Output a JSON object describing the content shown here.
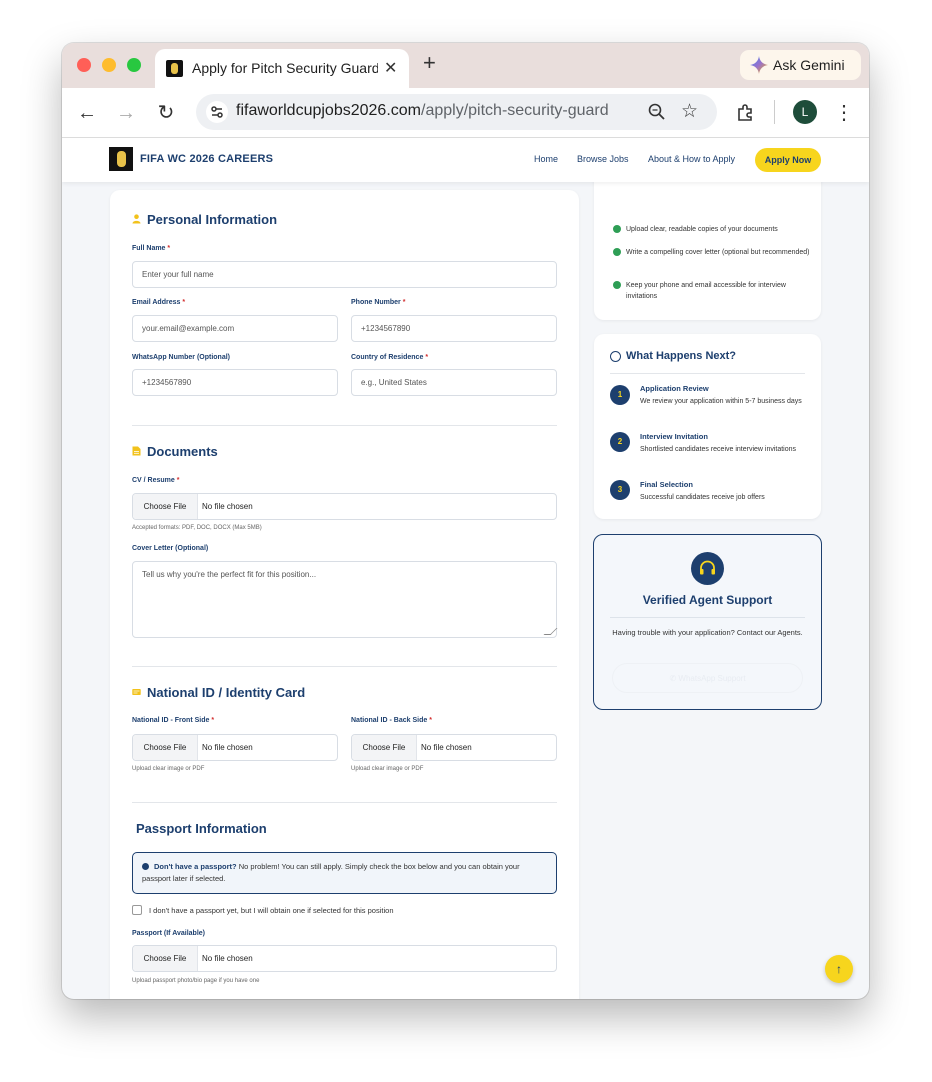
{
  "browser": {
    "tab_title": "Apply for Pitch Security Guard",
    "url_domain": "fifaworldcupjobs2026.com",
    "url_path": "/apply/pitch-security-guard",
    "gemini_label": "Ask Gemini",
    "profile_initial": "L"
  },
  "site": {
    "logo_text": "FIFA WC 2026 CAREERS",
    "nav": [
      "Home",
      "Browse Jobs",
      "About & How to Apply"
    ],
    "apply_button": "Apply Now"
  },
  "form": {
    "personal": {
      "title": "Personal Information",
      "full_name_label": "Full Name",
      "full_name_placeholder": "Enter your full name",
      "email_label": "Email Address",
      "email_placeholder": "your.email@example.com",
      "phone_label": "Phone Number",
      "phone_placeholder": "+1234567890",
      "whatsapp_label": "WhatsApp Number (Optional)",
      "whatsapp_placeholder": "+1234567890",
      "country_label": "Country of Residence",
      "country_placeholder": "e.g., United States"
    },
    "documents": {
      "title": "Documents",
      "cv_label": "CV / Resume",
      "cv_hint": "Accepted formats: PDF, DOC, DOCX (Max 5MB)",
      "cover_label": "Cover Letter (Optional)",
      "cover_placeholder": "Tell us why you're the perfect fit for this position..."
    },
    "national_id": {
      "title": "National ID / Identity Card",
      "front_label": "National ID - Front Side",
      "back_label": "National ID - Back Side",
      "hint": "Upload clear image or PDF"
    },
    "passport": {
      "title": "Passport Information",
      "info_bold": "Don't have a passport?",
      "info_text": " No problem! You can still apply. Simply check the box below and you can obtain your passport later if selected.",
      "checkbox_label": "I don't have a passport yet, but I will obtain one if selected for this position",
      "passport_label": "Passport (If Available)",
      "passport_hint": "Upload passport photo/bio page if you have one"
    },
    "file": {
      "choose": "Choose File",
      "none": "No file chosen"
    },
    "required_mark": "*"
  },
  "tips": [
    "Upload clear, readable copies of your documents",
    "Write a compelling cover letter (optional but recommended)",
    "Keep your phone and email accessible for interview invitations"
  ],
  "next_steps": {
    "title": "What Happens Next?",
    "steps": [
      {
        "num": "1",
        "title": "Application Review",
        "desc": "We review your application within 5-7 business days"
      },
      {
        "num": "2",
        "title": "Interview Invitation",
        "desc": "Shortlisted candidates receive interview invitations"
      },
      {
        "num": "3",
        "title": "Final Selection",
        "desc": "Successful candidates receive job offers"
      }
    ]
  },
  "support": {
    "title": "Verified Agent Support",
    "desc": "Having trouble with your application? Contact our Agents.",
    "button": "WhatsApp Support"
  },
  "scroll_top": "↑",
  "colors": {
    "brand_navy": "#1d3f6e",
    "accent_yellow": "#f7d51d",
    "required_red": "#d32f2f",
    "check_green": "#2e9e55"
  }
}
